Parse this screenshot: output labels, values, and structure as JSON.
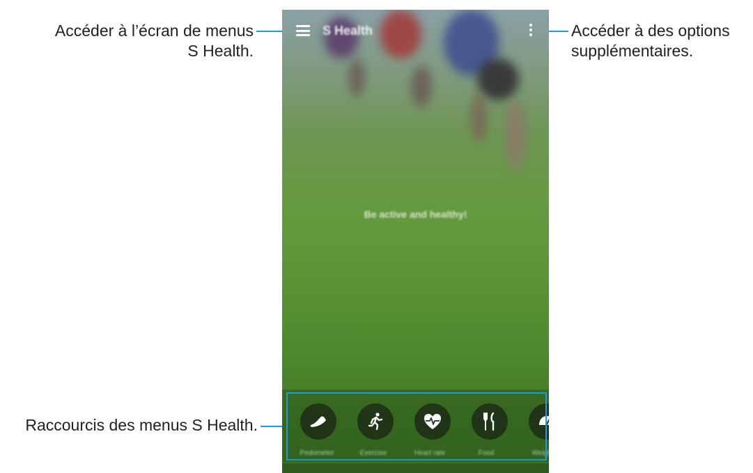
{
  "app": {
    "title": "S Health",
    "slogan": "Be active and healthy!"
  },
  "callouts": {
    "menu_line1": "Accéder à l’écran de menus",
    "menu_line2": "S Health.",
    "options_line1": "Accéder à des options",
    "options_line2": "supplémentaires.",
    "shortcuts": "Raccourcis des menus S Health."
  },
  "shortcuts": [
    {
      "icon": "shoe-icon",
      "label": "Pedometer"
    },
    {
      "icon": "runner-icon",
      "label": "Exercise"
    },
    {
      "icon": "heart-rate-icon",
      "label": "Heart rate"
    },
    {
      "icon": "fork-knife-icon",
      "label": "Food"
    },
    {
      "icon": "scale-icon",
      "label": "Weight"
    }
  ],
  "colors": {
    "leader": "#1a9be0",
    "text": "#231f20"
  }
}
